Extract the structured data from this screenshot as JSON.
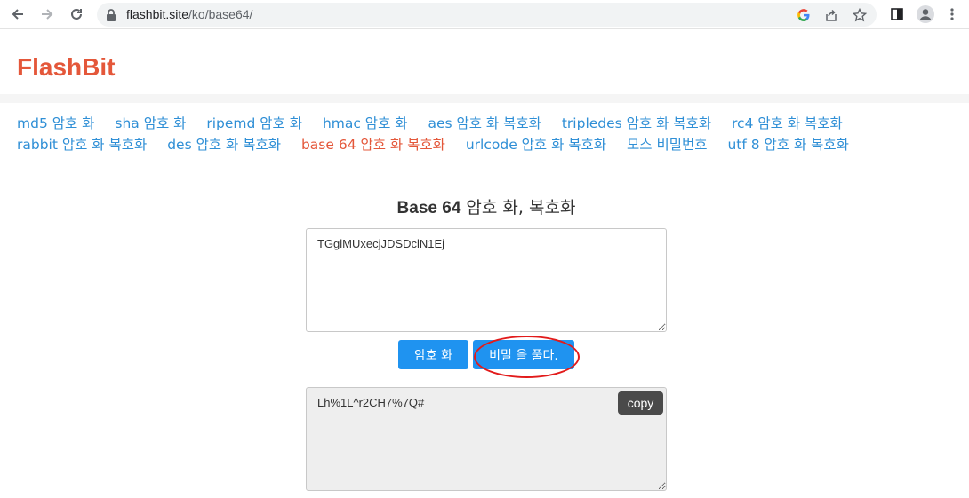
{
  "browser": {
    "url_host": "flashbit.site",
    "url_path": "/ko/base64/",
    "icons": [
      "back-arrow-icon",
      "forward-arrow-icon",
      "reload-icon",
      "lock-icon",
      "google-icon",
      "share-icon",
      "star-icon",
      "sidepanel-icon",
      "profile-icon",
      "more-icon"
    ]
  },
  "site": {
    "logo": "FlashBit",
    "nav": [
      {
        "label": "md5 암호 화",
        "active": false
      },
      {
        "label": "sha 암호 화",
        "active": false
      },
      {
        "label": "ripemd 암호 화",
        "active": false
      },
      {
        "label": "hmac 암호 화",
        "active": false
      },
      {
        "label": "aes 암호 화 복호화",
        "active": false
      },
      {
        "label": "tripledes 암호 화 복호화",
        "active": false
      },
      {
        "label": "rc4 암호 화 복호화",
        "active": false
      },
      {
        "label": "rabbit 암호 화 복호화",
        "active": false
      },
      {
        "label": "des 암호 화 복호화",
        "active": false
      },
      {
        "label": "base 64 암호 화 복호화",
        "active": true
      },
      {
        "label": "urlcode 암호 화 복호화",
        "active": false
      },
      {
        "label": "모스 비밀번호",
        "active": false
      },
      {
        "label": "utf 8 암호 화 복호화",
        "active": false
      }
    ],
    "link_color": "#2f8fd6",
    "active_color": "#e4573a"
  },
  "main": {
    "title_bold": "Base 64",
    "title_rest": " 암호 화, 복호화",
    "input_value": "TGglMUxecjJDSDclN1Ej",
    "encode_label": "암호 화",
    "decode_label": "비밀 을 풀다.",
    "output_value": "Lh%1L^r2CH7%7Q#",
    "copy_label": "copy",
    "button_color": "#1f93f0",
    "highlight_color": "#e21b1b"
  }
}
